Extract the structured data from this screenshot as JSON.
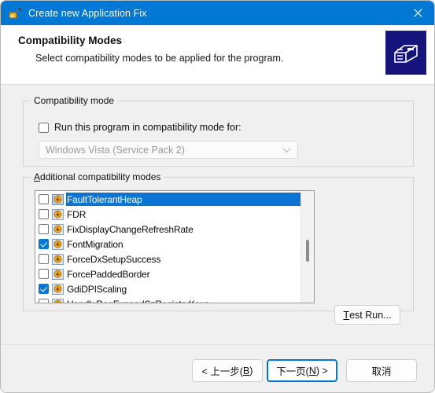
{
  "window": {
    "title": "Create new Application Fix",
    "icon": "compat-admin-icon",
    "close_icon": "close-icon",
    "accent_color": "#0078d4"
  },
  "header": {
    "title": "Compatibility Modes",
    "subtitle": "Select compatibility modes to be applied for the program.",
    "graphic_icon": "wizard-banner-icon"
  },
  "compatibility_mode_group": {
    "legend": "Compatibility mode",
    "checkbox": {
      "label": "Run this program in compatibility mode for:",
      "checked": false
    },
    "combobox": {
      "value": "Windows Vista (Service Pack 2)",
      "enabled": false,
      "chevron_icon": "chevron-down-icon"
    }
  },
  "additional_modes_group": {
    "legend_prefix": "A",
    "legend_rest": "dditional compatibility modes",
    "items": [
      {
        "label": "FaultTolerantHeap",
        "checked": false,
        "selected": true
      },
      {
        "label": "FDR",
        "checked": false,
        "selected": false
      },
      {
        "label": "FixDisplayChangeRefreshRate",
        "checked": false,
        "selected": false
      },
      {
        "label": "FontMigration",
        "checked": true,
        "selected": false
      },
      {
        "label": "ForceDxSetupSuccess",
        "checked": false,
        "selected": false
      },
      {
        "label": "ForcePaddedBorder",
        "checked": false,
        "selected": false
      },
      {
        "label": "GdiDPIScaling",
        "checked": true,
        "selected": false
      },
      {
        "label": "HandleRegExpandSzRegistryKeys",
        "checked": false,
        "selected": false
      }
    ],
    "item_icon": "compat-mode-icon"
  },
  "buttons": {
    "test_run_prefix": "T",
    "test_run_rest": "est Run...",
    "back_prefix": "< 上一步(",
    "back_key": "B",
    "back_suffix": ")",
    "next_prefix": "下一页(",
    "next_key": "N",
    "next_suffix": ") >",
    "cancel": "取消"
  }
}
